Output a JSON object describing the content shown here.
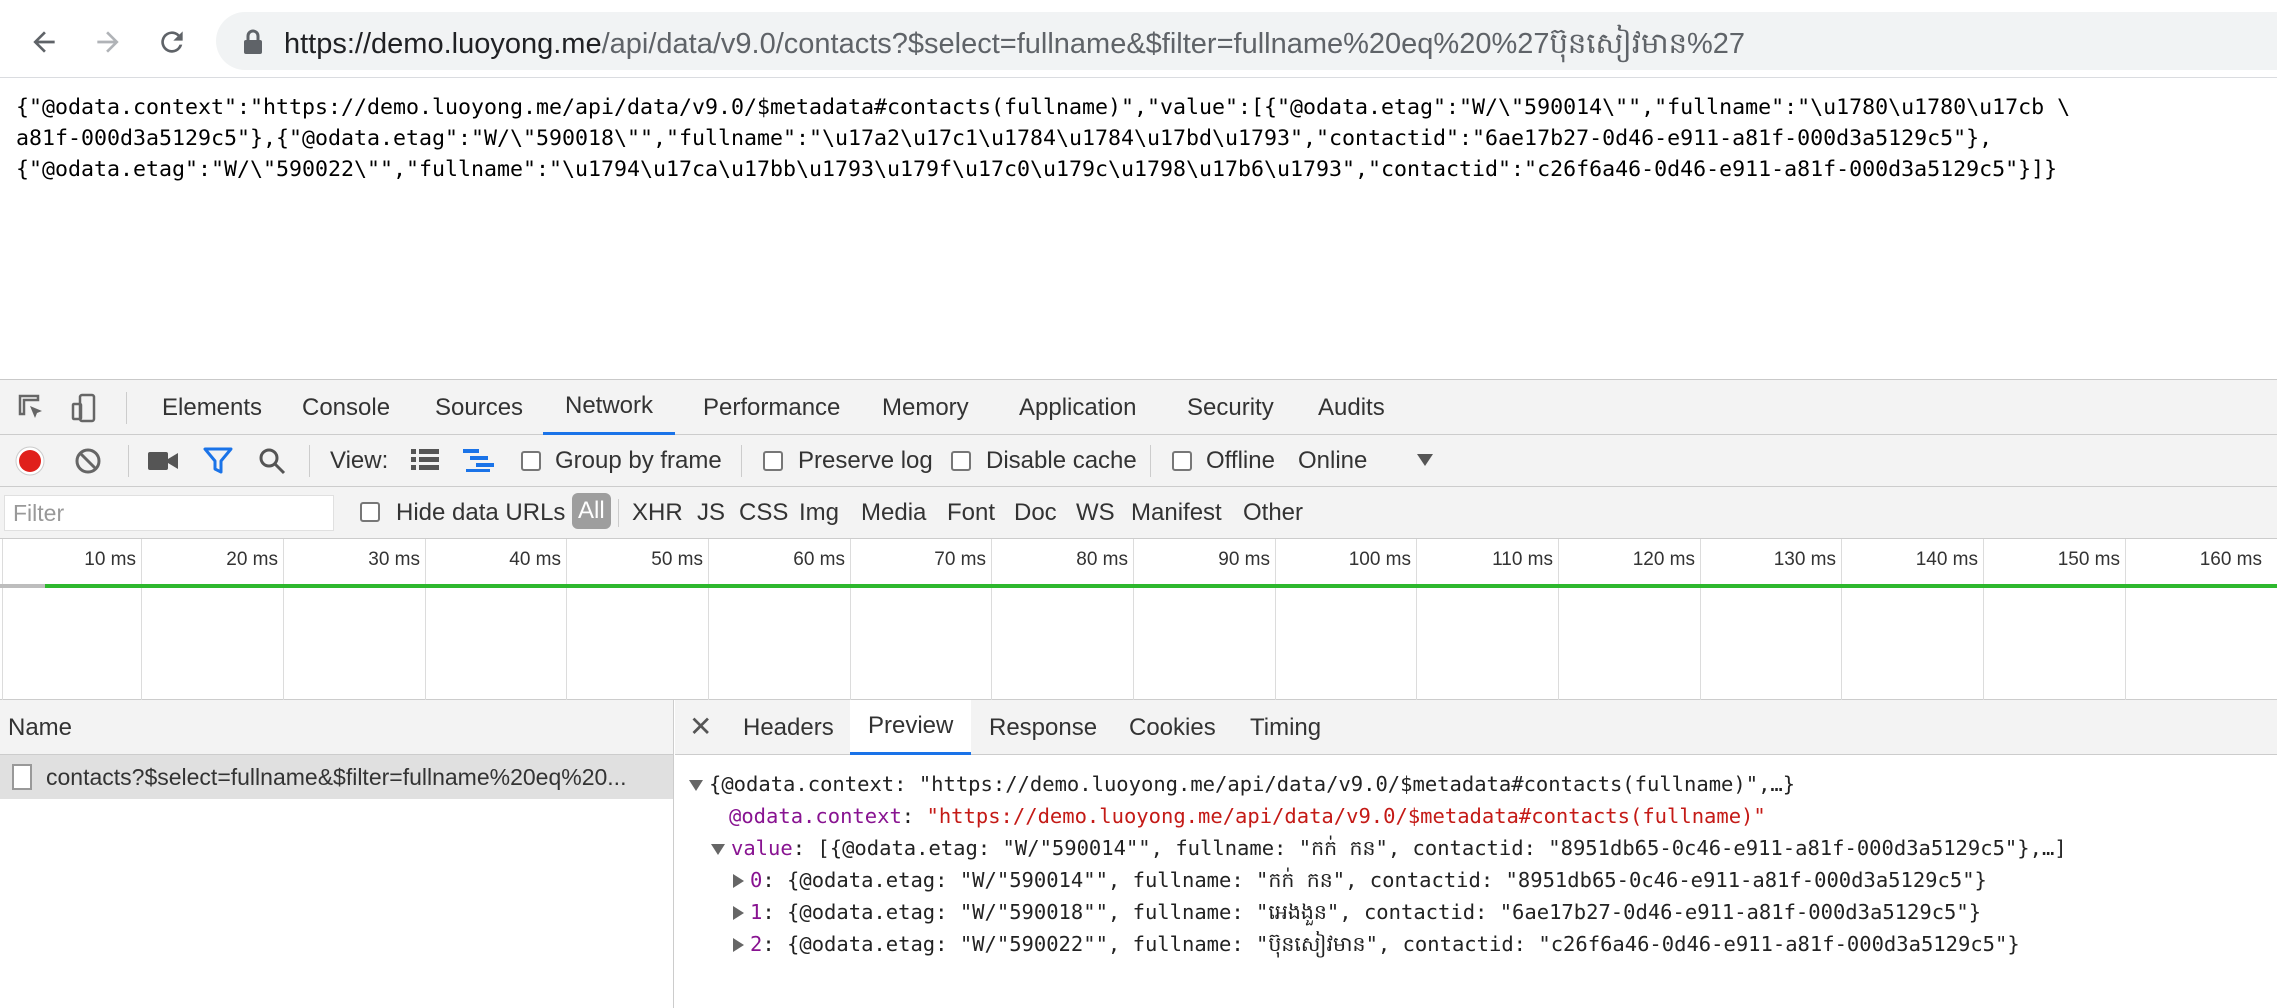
{
  "browser": {
    "url_host": "https://demo.luoyong.me",
    "url_path": "/api/data/v9.0/contacts?$select=fullname&$filter=fullname%20eq%20%27ប៊ុនសៀវមាន%27"
  },
  "page": {
    "json_lines": [
      "{\"@odata.context\":\"https://demo.luoyong.me/api/data/v9.0/$metadata#contacts(fullname)\",\"value\":[{\"@odata.etag\":\"W/\\\"590014\\\"\",\"fullname\":\"\\u1780\\u1780\\u17cb \\",
      "a81f-000d3a5129c5\"},{\"@odata.etag\":\"W/\\\"590018\\\"\",\"fullname\":\"\\u17a2\\u17c1\\u1784\\u1784\\u17bd\\u1793\",\"contactid\":\"6ae17b27-0d46-e911-a81f-000d3a5129c5\"},",
      "{\"@odata.etag\":\"W/\\\"590022\\\"\",\"fullname\":\"\\u1794\\u17ca\\u17bb\\u1793\\u179f\\u17c0\\u179c\\u1798\\u17b6\\u1793\",\"contactid\":\"c26f6a46-0d46-e911-a81f-000d3a5129c5\"}]}"
    ]
  },
  "devtools": {
    "tabs": [
      "Elements",
      "Console",
      "Sources",
      "Network",
      "Performance",
      "Memory",
      "Application",
      "Security",
      "Audits"
    ],
    "active_tab": "Network",
    "toolbar": {
      "view_label": "View:",
      "group_by_frame": "Group by frame",
      "preserve_log": "Preserve log",
      "disable_cache": "Disable cache",
      "offline": "Offline",
      "throttle": "Online"
    },
    "filter": {
      "placeholder": "Filter",
      "hide_data_urls": "Hide data URLs",
      "types": [
        "All",
        "XHR",
        "JS",
        "CSS",
        "Img",
        "Media",
        "Font",
        "Doc",
        "WS",
        "Manifest",
        "Other"
      ]
    },
    "timeline_ticks": [
      "10 ms",
      "20 ms",
      "30 ms",
      "40 ms",
      "50 ms",
      "60 ms",
      "70 ms",
      "80 ms",
      "90 ms",
      "100 ms",
      "110 ms",
      "120 ms",
      "130 ms",
      "140 ms",
      "150 ms",
      "160 ms"
    ],
    "name_header": "Name",
    "request_name": "contacts?$select=fullname&$filter=fullname%20eq%20...",
    "detail_tabs": [
      "Headers",
      "Preview",
      "Response",
      "Cookies",
      "Timing"
    ],
    "active_detail_tab": "Preview",
    "preview": {
      "root": "{@odata.context: \"https://demo.luoyong.me/api/data/v9.0/$metadata#contacts(fullname)\",…}",
      "context_key": "@odata.context",
      "context_value": "\"https://demo.luoyong.me/api/data/v9.0/$metadata#contacts(fullname)\"",
      "value_key": "value",
      "value_summary": "[{@odata.etag: \"W/\"590014\"\", fullname: \"កក់ កន\", contactid: \"8951db65-0c46-e911-a81f-000d3a5129c5\"},…]",
      "items": [
        {
          "index": "0",
          "text": "{@odata.etag: \"W/\"590014\"\", fullname: \"កក់ កន\", contactid: \"8951db65-0c46-e911-a81f-000d3a5129c5\"}"
        },
        {
          "index": "1",
          "text": "{@odata.etag: \"W/\"590018\"\", fullname: \"អេងងួន\", contactid: \"6ae17b27-0d46-e911-a81f-000d3a5129c5\"}"
        },
        {
          "index": "2",
          "text": "{@odata.etag: \"W/\"590022\"\", fullname: \"ប៊ុនសៀវមាន\", contactid: \"c26f6a46-0d46-e911-a81f-000d3a5129c5\"}"
        }
      ]
    }
  },
  "colors": {
    "accent": "#1a73e8",
    "record": "#e0201b",
    "timeline_bar": "#2eb82e",
    "preview_key": "#881391",
    "preview_string": "#c41a16"
  }
}
